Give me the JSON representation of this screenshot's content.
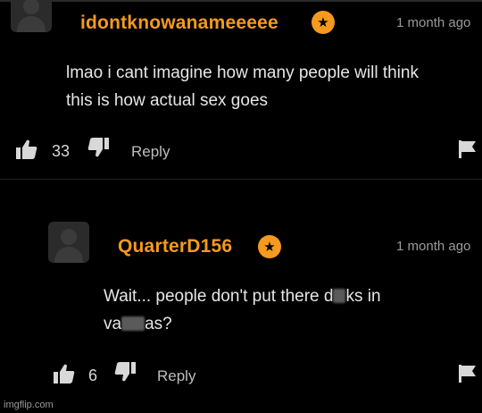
{
  "comments": [
    {
      "username": "idontknowanameeeee",
      "time": "1 month ago",
      "text_lines": [
        "lmao i cant imagine how many people will think",
        "this is how actual sex goes"
      ],
      "likes": "33",
      "reply_label": "Reply"
    },
    {
      "username": "QuarterD156",
      "time": "1 month ago",
      "text_line1_a": "Wait... people don't put there d",
      "text_line1_b": "ks in",
      "text_line2_a": "va",
      "text_line2_b": "as?",
      "likes": "6",
      "reply_label": "Reply"
    }
  ],
  "badge_icon": "star-icon",
  "colors": {
    "accent": "#f59a1e",
    "background": "#000000"
  },
  "watermark": "imgflip.com"
}
